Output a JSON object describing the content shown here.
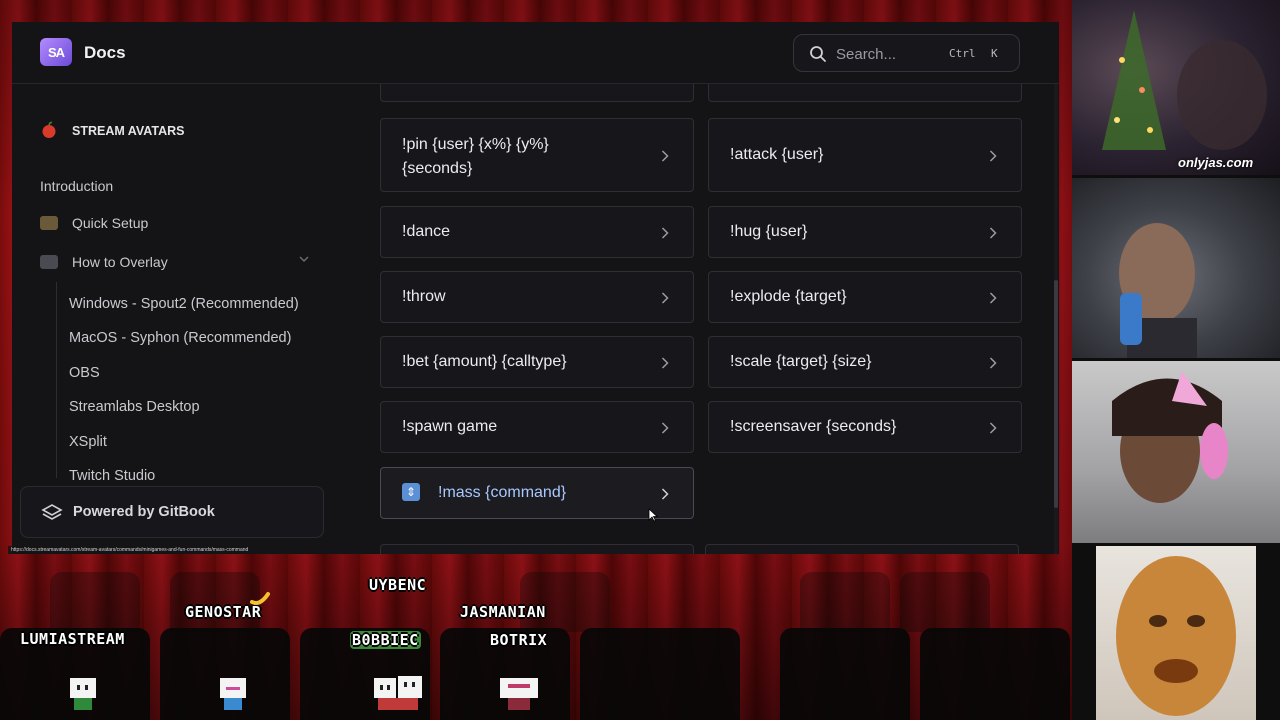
{
  "docs": {
    "title": "Docs",
    "logo_text": "SA",
    "search": {
      "placeholder": "Search...",
      "shortcut": [
        "Ctrl",
        "K"
      ]
    },
    "sidebar": {
      "section": "STREAM AVATARS",
      "items": [
        {
          "label": "Introduction",
          "icon": "none"
        },
        {
          "label": "Quick Setup",
          "icon": "fast-forward-icon"
        },
        {
          "label": "How to Overlay",
          "icon": "camera-icon",
          "expanded": true
        }
      ],
      "subitems": [
        "Windows - Spout2 (Recommended)",
        "MacOS - Syphon (Recommended)",
        "OBS",
        "Streamlabs Desktop",
        "XSplit",
        "Twitch Studio"
      ],
      "powered_by": "Powered by GitBook"
    },
    "commands": [
      [
        "!pin {user} {x%} {y%} {seconds}",
        "!attack {user}"
      ],
      [
        "!dance",
        "!hug {user}"
      ],
      [
        "!throw",
        "!explode {target}"
      ],
      [
        "!bet {amount} {calltype}",
        "!scale {target} {size}"
      ],
      [
        "!spawn game",
        "!screensaver {seconds}"
      ],
      [
        "!mass {command}"
      ]
    ],
    "status_url": "https://docs.streamavatars.com/stream-avatars/commands/minigames-and-fun-commands/mass-command"
  },
  "stream": {
    "watermark": "onlyjas.com",
    "avatars": [
      "LUMIASTREAM",
      "GENOSTAR",
      "UYBENC",
      "B0BBIEC",
      "JASMANIAN",
      "BOTRIX"
    ]
  },
  "colors": {
    "accent": "#a8c8ff",
    "background": "#141417",
    "curtain": "#8c1016"
  }
}
